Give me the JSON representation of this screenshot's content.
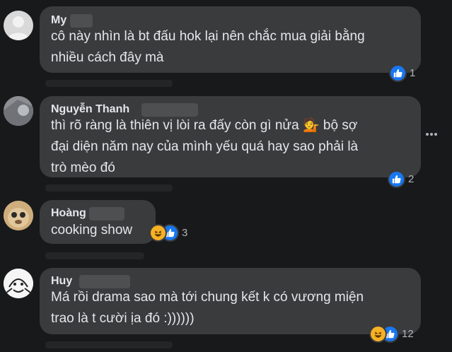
{
  "comments": [
    {
      "name": "My",
      "text_lines": [
        "cô này nhìn là bt đấu hok lại nên chắc mua giải bằng",
        "nhiều cách đây mà"
      ],
      "reactions": [
        "like"
      ],
      "reaction_count": "1"
    },
    {
      "name": "Nguyễn Thanh",
      "text_lines": [
        "thì rõ ràng là thiên vị lòi ra đấy còn gì nửa 💁 bộ sợ",
        "đại diện năm nay của mình yếu quá hay sao phải là",
        "trò mèo đó"
      ],
      "reactions": [
        "like"
      ],
      "reaction_count": "2"
    },
    {
      "name": "Hoàng",
      "text_lines": [
        "cooking show"
      ],
      "reactions": [
        "haha",
        "like"
      ],
      "reaction_count": "3"
    },
    {
      "name": "Huy",
      "text_lines": [
        "Má rồi drama sao mà tới chung kết k có vương miện",
        "trao là t cười ịa đó :))))))"
      ],
      "reactions": [
        "haha",
        "like"
      ],
      "reaction_count": "12"
    }
  ],
  "icons": {
    "like": "thumbs-up-icon",
    "haha": "laughing-face-icon",
    "more": "more-options-icon"
  },
  "colors": {
    "background": "#18191a",
    "bubble": "#3a3b3c",
    "text": "#e4e6eb",
    "secondary": "#b0b3b8",
    "like": "#1877f2"
  }
}
